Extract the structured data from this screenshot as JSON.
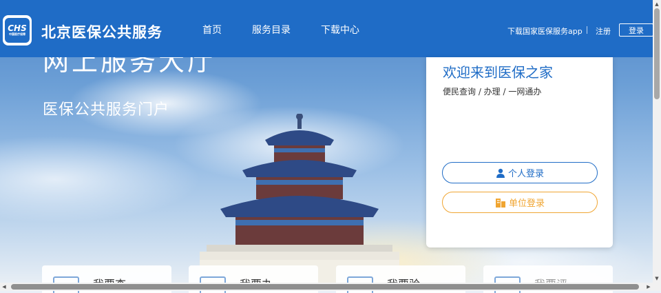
{
  "header": {
    "logo_text": "CHS",
    "logo_subtext": "中国医疗保障",
    "site_name": "北京医保公共服务",
    "nav": [
      "首页",
      "服务目录",
      "下载中心"
    ],
    "app_link": "下载国家医保服务app",
    "register": "注册",
    "login": "登录"
  },
  "hero": {
    "title": "网上服务大厅",
    "subtitle": "医保公共服务门户"
  },
  "card": {
    "title": "欢迎来到医保之家",
    "subtitle": "便民查询 / 办理 / 一网通办",
    "personal_login": "个人登录",
    "unit_login": "单位登录"
  },
  "services": [
    "我要查",
    "我要办",
    "我要验",
    "我要评"
  ],
  "colors": {
    "header_blue": "#1f6cc6",
    "unit_orange": "#f0a531"
  }
}
